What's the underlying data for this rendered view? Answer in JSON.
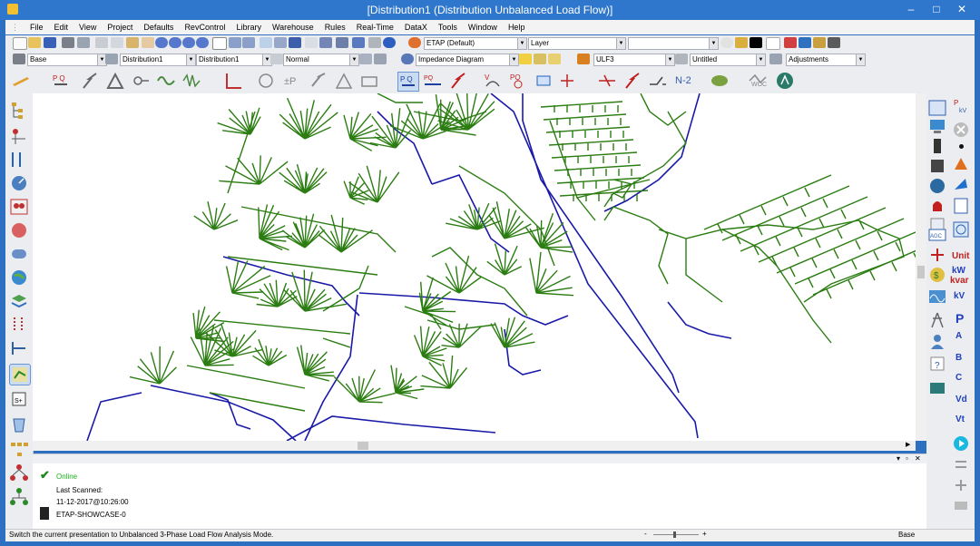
{
  "window": {
    "title": "[Distribution1 (Distribution Unbalanced Load Flow)]",
    "minimize": "–",
    "maximize": "□",
    "close": "✕"
  },
  "menu": [
    "File",
    "Edit",
    "View",
    "Project",
    "Defaults",
    "RevControl",
    "Library",
    "Warehouse",
    "Rules",
    "Real-Time",
    "DataX",
    "Tools",
    "Window",
    "Help"
  ],
  "toolbar1": {
    "style_combo": "ETAP (Default)",
    "layer_combo": "Layer",
    "blank_combo": ""
  },
  "toolbar2": {
    "base_combo": "Base",
    "config1": "Distribution1",
    "config2": "Distribution1",
    "mode": "Normal",
    "diagram": "Impedance Diagram",
    "study": "ULF3",
    "output": "Untitled",
    "adjust": "Adjustments"
  },
  "toolbar3": {
    "n2_label": "N-2",
    "woc_label": "WOC"
  },
  "right_labels": {
    "unit": "Unit",
    "kw": "kW",
    "kvar": "kvar",
    "kv": "kV",
    "p": "P",
    "a": "A",
    "b": "B",
    "c": "C",
    "vd": "Vd",
    "vt": "Vt"
  },
  "panel": {
    "online": "Online",
    "last_scanned_label": "Last Scanned:",
    "last_scanned_value": "11-12-2017@10:26:00",
    "server": "ETAP-SHOWCASE-0"
  },
  "status": {
    "message": "Switch the current presentation to Unbalanced 3-Phase Load Flow Analysis Mode.",
    "mode": "Base"
  },
  "colors": {
    "feeder": "#1a1aa8",
    "laterals": "#2b7d12",
    "title_bar": "#2f77cc"
  }
}
